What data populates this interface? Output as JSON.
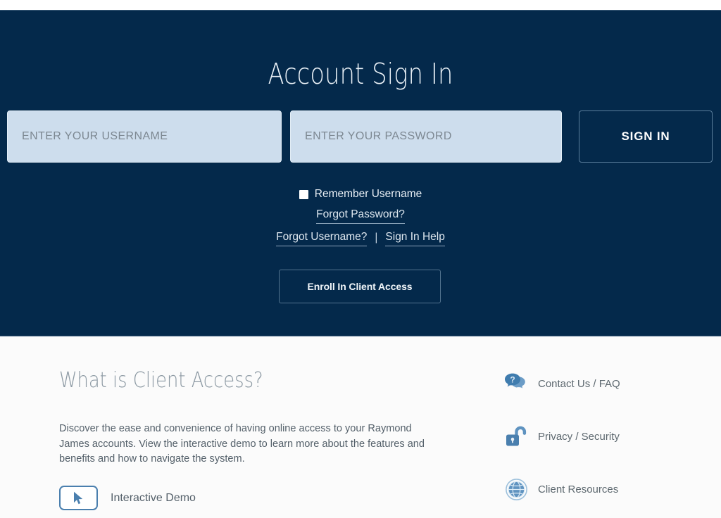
{
  "hero": {
    "title": "Account Sign In",
    "username": {
      "placeholder": "ENTER YOUR USERNAME",
      "value": ""
    },
    "password": {
      "placeholder": "ENTER YOUR PASSWORD",
      "value": ""
    },
    "signin_label": "SIGN IN",
    "remember_label": "Remember Username",
    "remember_checked": false,
    "forgot_password_label": "Forgot Password?",
    "forgot_username_label": "Forgot Username?",
    "link_separator": "|",
    "signin_help_label": "Sign In Help",
    "enroll_label": "Enroll In Client Access",
    "background_color": "#04294b"
  },
  "about": {
    "heading": "What is Client Access?",
    "body": "Discover the ease and convenience of having online access to your Raymond James accounts. View the interactive demo to learn more about the features and benefits and how to navigate the system.",
    "demo_label": "Interactive Demo",
    "demo_icon": "cursor-pointer-icon"
  },
  "side_links": [
    {
      "label": "Contact Us / FAQ",
      "icon": "speech-bubbles-question-icon"
    },
    {
      "label": "Privacy / Security",
      "icon": "open-padlock-icon"
    },
    {
      "label": "Client Resources",
      "icon": "globe-icon"
    }
  ],
  "colors": {
    "navy": "#04294b",
    "field_fill": "#cddded",
    "icon_blue": "#4a7fae",
    "body_text": "#54606a"
  }
}
